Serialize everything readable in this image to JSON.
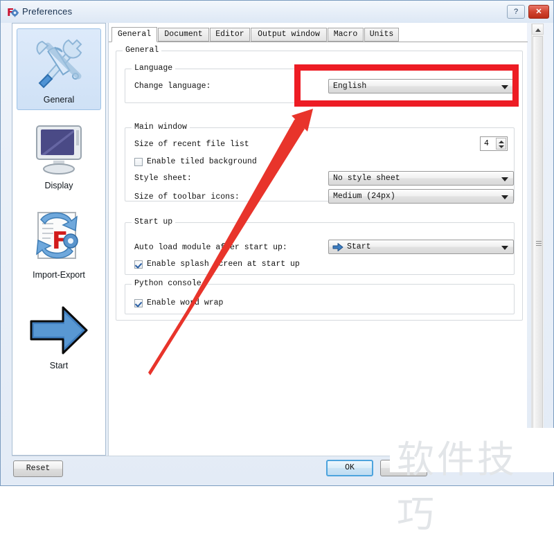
{
  "window": {
    "title": "Preferences",
    "icon": "freecad-icon",
    "help_button": "?",
    "close_button": "✕"
  },
  "sidebar": {
    "items": [
      {
        "label": "General",
        "icon": "tools-icon",
        "selected": true
      },
      {
        "label": "Display",
        "icon": "monitor-icon",
        "selected": false
      },
      {
        "label": "Import-Export",
        "icon": "import-export-icon",
        "selected": false
      },
      {
        "label": "Start",
        "icon": "blue-arrow-icon",
        "selected": false
      }
    ]
  },
  "tabs": [
    {
      "label": "General",
      "active": true
    },
    {
      "label": "Document",
      "active": false
    },
    {
      "label": "Editor",
      "active": false
    },
    {
      "label": "Output window",
      "active": false
    },
    {
      "label": "Macro",
      "active": false
    },
    {
      "label": "Units",
      "active": false
    }
  ],
  "general_group": {
    "title": "General",
    "language_group": {
      "title": "Language",
      "change_language_label": "Change language:",
      "change_language_value": "English"
    },
    "main_window_group": {
      "title": "Main window",
      "recent_file_list_label": "Size of recent file list",
      "recent_file_list_value": "4",
      "tiled_background_label": "Enable tiled background",
      "tiled_background_checked": false,
      "style_sheet_label": "Style sheet:",
      "style_sheet_value": "No style sheet",
      "toolbar_icons_label": "Size of toolbar icons:",
      "toolbar_icons_value": "Medium (24px)"
    },
    "start_up_group": {
      "title": "Start up",
      "auto_load_label": "Auto load module after start up:",
      "auto_load_value": "Start",
      "auto_load_icon": "blue-arrow-icon",
      "splash_screen_label": "Enable splash screen at start up",
      "splash_screen_checked": true
    },
    "python_console_group": {
      "title": "Python console",
      "word_wrap_label": "Enable word wrap",
      "word_wrap_checked": true
    }
  },
  "footer": {
    "reset_label": "Reset",
    "ok_label": "OK"
  },
  "annotations": {
    "highlight_color": "#ed1c24",
    "highlight_target": "change-language-combobox",
    "arrow_color": "#e8342b"
  },
  "watermark": {
    "text": "软件技巧"
  }
}
